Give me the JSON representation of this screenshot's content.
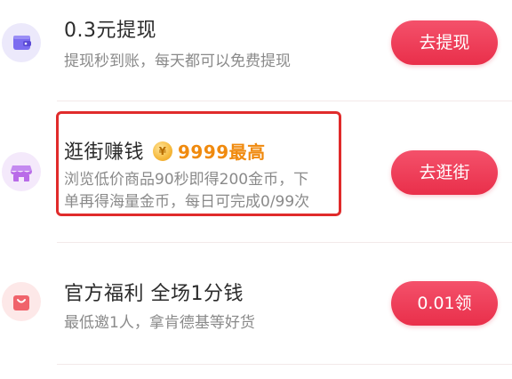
{
  "tasks": [
    {
      "title": "0.3元提现",
      "desc_lines": [
        "提现秒到账，每天都可以免费提现"
      ],
      "button": "去提现",
      "icon": "wallet-icon",
      "icon_bg": "#ece9fb",
      "icon_color": "#7b6cf0"
    },
    {
      "title": "逛街赚钱",
      "reward_text": "9999最高",
      "coin_glyph": "¥",
      "desc_lines": [
        "浏览低价商品90秒即得200金币，下",
        "单再得海量金币，每日可完成0/99次"
      ],
      "button": "去逛街",
      "icon": "shop-icon",
      "icon_bg": "#f4e9fb",
      "icon_color": "#b96be8",
      "highlighted": true
    },
    {
      "title": "官方福利 全场1分钱",
      "desc_lines": [
        "最低邀1人，拿肯德基等好货"
      ],
      "button": "0.01领",
      "icon": "shopping-bag-icon",
      "icon_bg": "#fde8e8",
      "icon_color": "#f0636b"
    }
  ],
  "colors": {
    "button": "#ec3a55",
    "reward": "#f08a0e",
    "highlight_border": "#e02b2b"
  }
}
